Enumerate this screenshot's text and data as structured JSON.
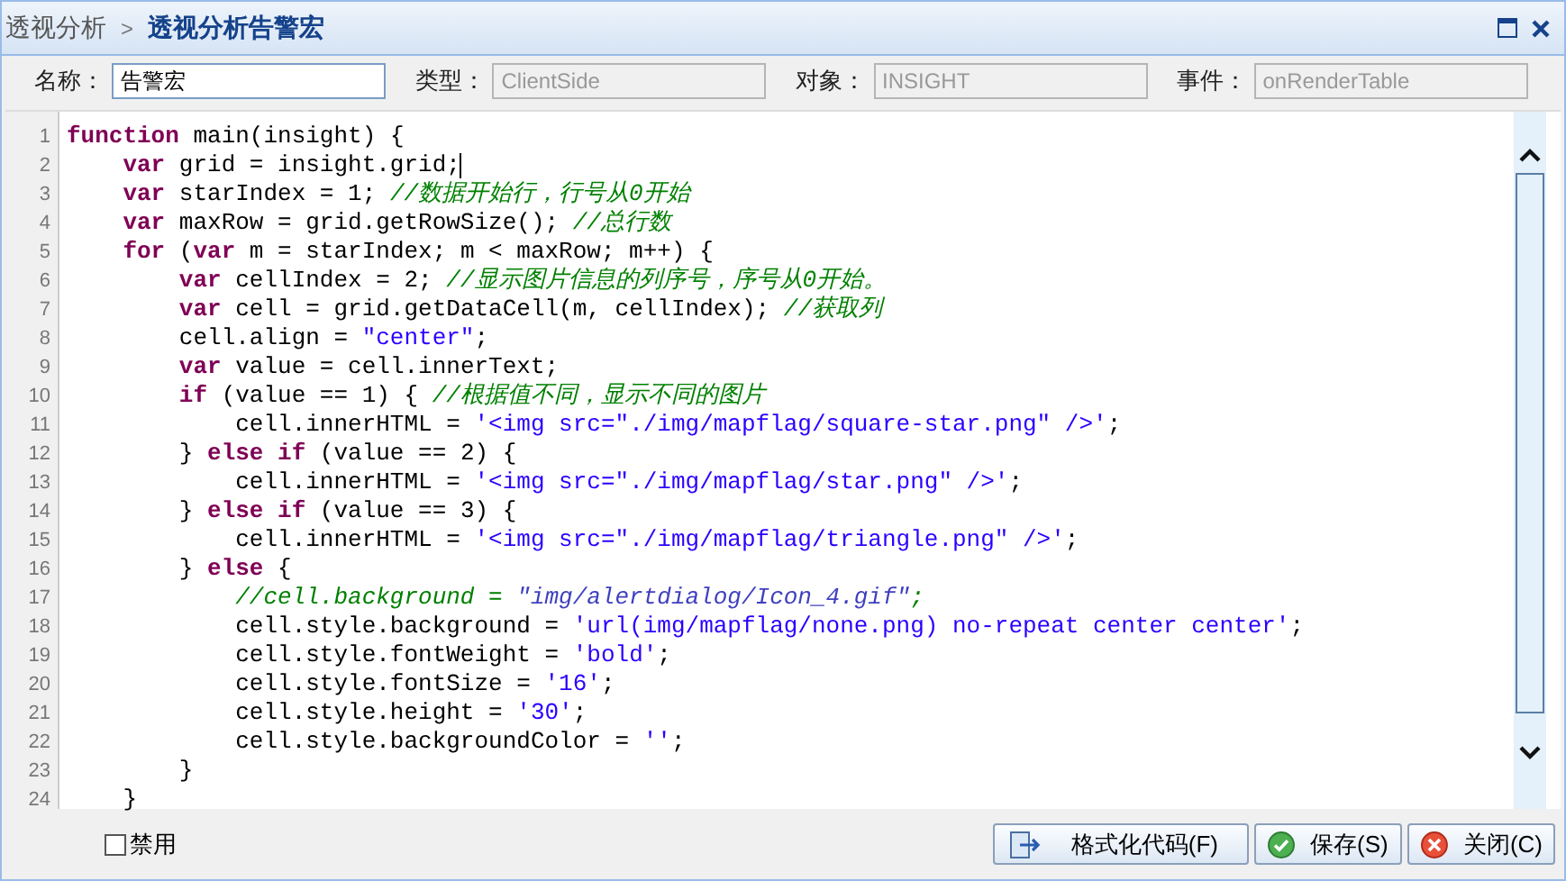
{
  "breadcrumb": {
    "parent": "透视分析",
    "separator": ">",
    "current": "透视分析告警宏"
  },
  "fields": [
    {
      "label": "名称：",
      "value": "告警宏",
      "disabled": false
    },
    {
      "label": "类型：",
      "value": "ClientSide",
      "disabled": true
    },
    {
      "label": "对象：",
      "value": "INSIGHT",
      "disabled": true
    },
    {
      "label": "事件：",
      "value": "onRenderTable",
      "disabled": true
    }
  ],
  "editor": {
    "lines": [
      {
        "number": "1",
        "caret": false,
        "tokens": [
          {
            "kind": "keyword",
            "text": "function"
          },
          {
            "kind": "plain",
            "text": " main(insight) {"
          }
        ]
      },
      {
        "number": "2",
        "caret": true,
        "tokens": [
          {
            "kind": "keyword",
            "text": "    var"
          },
          {
            "kind": "plain",
            "text": " grid = insight.grid;"
          }
        ]
      },
      {
        "number": "3",
        "caret": false,
        "tokens": [
          {
            "kind": "keyword",
            "text": "    var"
          },
          {
            "kind": "plain",
            "text": " starIndex = 1; "
          },
          {
            "kind": "comment",
            "text": "//数据开始行，行号从0开始"
          }
        ]
      },
      {
        "number": "4",
        "caret": false,
        "tokens": [
          {
            "kind": "keyword",
            "text": "    var"
          },
          {
            "kind": "plain",
            "text": " maxRow = grid.getRowSize(); "
          },
          {
            "kind": "comment",
            "text": "//总行数"
          }
        ]
      },
      {
        "number": "5",
        "caret": false,
        "tokens": [
          {
            "kind": "keyword",
            "text": "    for"
          },
          {
            "kind": "plain",
            "text": " ("
          },
          {
            "kind": "keyword",
            "text": "var"
          },
          {
            "kind": "plain",
            "text": " m = starIndex; m < maxRow; m++) {"
          }
        ]
      },
      {
        "number": "6",
        "caret": false,
        "tokens": [
          {
            "kind": "keyword",
            "text": "        var"
          },
          {
            "kind": "plain",
            "text": " cellIndex = 2; "
          },
          {
            "kind": "comment",
            "text": "//显示图片信息的列序号，序号从0开始。"
          }
        ]
      },
      {
        "number": "7",
        "caret": false,
        "tokens": [
          {
            "kind": "keyword",
            "text": "        var"
          },
          {
            "kind": "plain",
            "text": " cell = grid.getDataCell(m, cellIndex); "
          },
          {
            "kind": "comment",
            "text": "//获取列"
          }
        ]
      },
      {
        "number": "8",
        "caret": false,
        "tokens": [
          {
            "kind": "plain",
            "text": "        cell.align = "
          },
          {
            "kind": "string",
            "text": "\"center\""
          },
          {
            "kind": "plain",
            "text": ";"
          }
        ]
      },
      {
        "number": "9",
        "caret": false,
        "tokens": [
          {
            "kind": "keyword",
            "text": "        var"
          },
          {
            "kind": "plain",
            "text": " value = cell.innerText;"
          }
        ]
      },
      {
        "number": "10",
        "caret": false,
        "tokens": [
          {
            "kind": "keyword",
            "text": "        if"
          },
          {
            "kind": "plain",
            "text": " (value == 1) { "
          },
          {
            "kind": "comment",
            "text": "//根据值不同，显示不同的图片"
          }
        ]
      },
      {
        "number": "11",
        "caret": false,
        "tokens": [
          {
            "kind": "plain",
            "text": "            cell.innerHTML = "
          },
          {
            "kind": "string",
            "text": "'<img src=\"./img/mapflag/square-star.png\" />'"
          },
          {
            "kind": "plain",
            "text": ";"
          }
        ]
      },
      {
        "number": "12",
        "caret": false,
        "tokens": [
          {
            "kind": "plain",
            "text": "        } "
          },
          {
            "kind": "keyword",
            "text": "else if"
          },
          {
            "kind": "plain",
            "text": " (value == 2) {"
          }
        ]
      },
      {
        "number": "13",
        "caret": false,
        "tokens": [
          {
            "kind": "plain",
            "text": "            cell.innerHTML = "
          },
          {
            "kind": "string",
            "text": "'<img src=\"./img/mapflag/star.png\" />'"
          },
          {
            "kind": "plain",
            "text": ";"
          }
        ]
      },
      {
        "number": "14",
        "caret": false,
        "tokens": [
          {
            "kind": "plain",
            "text": "        } "
          },
          {
            "kind": "keyword",
            "text": "else if"
          },
          {
            "kind": "plain",
            "text": " (value == 3) {"
          }
        ]
      },
      {
        "number": "15",
        "caret": false,
        "tokens": [
          {
            "kind": "plain",
            "text": "            cell.innerHTML = "
          },
          {
            "kind": "string",
            "text": "'<img src=\"./img/mapflag/triangle.png\" />'"
          },
          {
            "kind": "plain",
            "text": ";"
          }
        ]
      },
      {
        "number": "16",
        "caret": false,
        "tokens": [
          {
            "kind": "plain",
            "text": "        } "
          },
          {
            "kind": "keyword",
            "text": "else"
          },
          {
            "kind": "plain",
            "text": " {"
          }
        ]
      },
      {
        "number": "17",
        "caret": false,
        "tokens": [
          {
            "kind": "comment",
            "text": "            //cell.background = "
          },
          {
            "kind": "comment_string",
            "text": "\"img/alertdialog/Icon_4.gif\""
          },
          {
            "kind": "comment",
            "text": ";"
          }
        ]
      },
      {
        "number": "18",
        "caret": false,
        "tokens": [
          {
            "kind": "plain",
            "text": "            cell.style.background = "
          },
          {
            "kind": "string",
            "text": "'url(img/mapflag/none.png) no-repeat center center'"
          },
          {
            "kind": "plain",
            "text": ";"
          }
        ]
      },
      {
        "number": "19",
        "caret": false,
        "tokens": [
          {
            "kind": "plain",
            "text": "            cell.style.fontWeight = "
          },
          {
            "kind": "string",
            "text": "'bold'"
          },
          {
            "kind": "plain",
            "text": ";"
          }
        ]
      },
      {
        "number": "20",
        "caret": false,
        "tokens": [
          {
            "kind": "plain",
            "text": "            cell.style.fontSize = "
          },
          {
            "kind": "string",
            "text": "'16'"
          },
          {
            "kind": "plain",
            "text": ";"
          }
        ]
      },
      {
        "number": "21",
        "caret": false,
        "tokens": [
          {
            "kind": "plain",
            "text": "            cell.style.height = "
          },
          {
            "kind": "string",
            "text": "'30'"
          },
          {
            "kind": "plain",
            "text": ";"
          }
        ]
      },
      {
        "number": "22",
        "caret": false,
        "tokens": [
          {
            "kind": "plain",
            "text": "            cell.style.backgroundColor = "
          },
          {
            "kind": "string",
            "text": "''"
          },
          {
            "kind": "plain",
            "text": ";"
          }
        ]
      },
      {
        "number": "23",
        "caret": false,
        "tokens": [
          {
            "kind": "plain",
            "text": "        }"
          }
        ]
      },
      {
        "number": "24",
        "caret": false,
        "tokens": [
          {
            "kind": "plain",
            "text": "    }"
          }
        ]
      }
    ]
  },
  "disable_checkbox": {
    "label": "禁用",
    "checked": false
  },
  "buttons": [
    {
      "kind": "format",
      "label": "格式化代码(F)"
    },
    {
      "kind": "save",
      "label": "保存(S)"
    },
    {
      "kind": "close",
      "label": "关闭(C)"
    }
  ]
}
